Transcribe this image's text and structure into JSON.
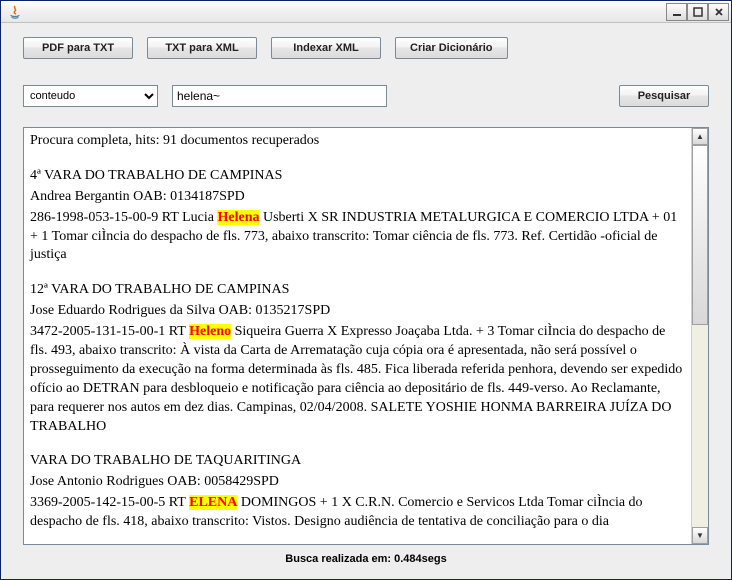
{
  "window": {
    "title": ""
  },
  "toolbar": {
    "pdf_to_txt": "PDF para TXT",
    "txt_to_xml": "TXT para XML",
    "index_xml": "Indexar XML",
    "create_dict": "Criar Dicionário"
  },
  "search": {
    "field_options": [
      "conteudo"
    ],
    "field_selected": "conteudo",
    "query": "helena~",
    "submit": "Pesquisar"
  },
  "results": {
    "summary": "Procura completa, hits: 91 documentos recuperados",
    "docs": [
      {
        "court": "4ª VARA DO TRABALHO DE CAMPINAS",
        "lawyer": "Andrea Bergantin OAB: 0134187SPD",
        "case_pre": "286-1998-053-15-00-9 RT Lucia ",
        "hit": "Helena",
        "case_post": " Usberti X SR INDUSTRIA METALURGICA E COMERCIO LTDA + 01 + 1 Tomar ciÌncia do despacho de fls. 773, abaixo transcrito: Tomar ciência de fls. 773. Ref. Certidão -oficial de justiça"
      },
      {
        "court": "12ª VARA DO TRABALHO DE CAMPINAS",
        "lawyer": "Jose Eduardo Rodrigues da Silva OAB: 0135217SPD",
        "case_pre": "3472-2005-131-15-00-1 RT ",
        "hit": "Heleno",
        "case_post": " Siqueira Guerra X Expresso Joaçaba Ltda. + 3 Tomar ciÌncia do despacho de fls. 493, abaixo transcrito: À vista da Carta de Arrematação cuja cópia ora é apresentada, não será possível o prosseguimento da execução na forma determinada às fls. 485. Fica liberada referida penhora, devendo ser expedido ofício ao DETRAN para desbloqueio e notificação para ciência ao depositário de fls. 449-verso. Ao Reclamante, para requerer nos autos em dez dias. Campinas, 02/04/2008. SALETE YOSHIE HONMA BARREIRA JUÍZA DO TRABALHO"
      },
      {
        "court": "VARA DO TRABALHO DE TAQUARITINGA",
        "lawyer": "Jose Antonio Rodrigues OAB: 0058429SPD",
        "case_pre": "3369-2005-142-15-00-5 RT ",
        "hit": "ELENA",
        "case_post": " DOMINGOS + 1 X C.R.N. Comercio e Servicos Ltda Tomar ciÌncia do despacho de fls. 418, abaixo transcrito: Vistos. Designo audiência de tentativa de conciliação para o dia"
      }
    ]
  },
  "status": {
    "label": "Busca realizada em: 0.484segs"
  }
}
